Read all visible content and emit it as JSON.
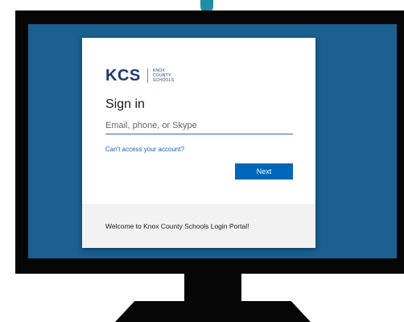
{
  "branding": {
    "logo_mark": "KCS",
    "logo_words": [
      "KNOX",
      "COUNTY",
      "SCHOOLS"
    ]
  },
  "signin": {
    "title": "Sign in",
    "email_placeholder": "Email, phone, or Skype",
    "email_value": "",
    "access_link": "Can't access your account?",
    "next_label": "Next"
  },
  "footer": {
    "welcome": "Welcome to Knox County Schools Login Portal!"
  },
  "colors": {
    "screen_background": "#1a5f8f",
    "button_primary": "#0067b8",
    "link": "#1a5fb4",
    "bezel": "#050505",
    "camera_accent": "#1f8fa6"
  },
  "icons": {
    "camera": "webcam-dot"
  }
}
